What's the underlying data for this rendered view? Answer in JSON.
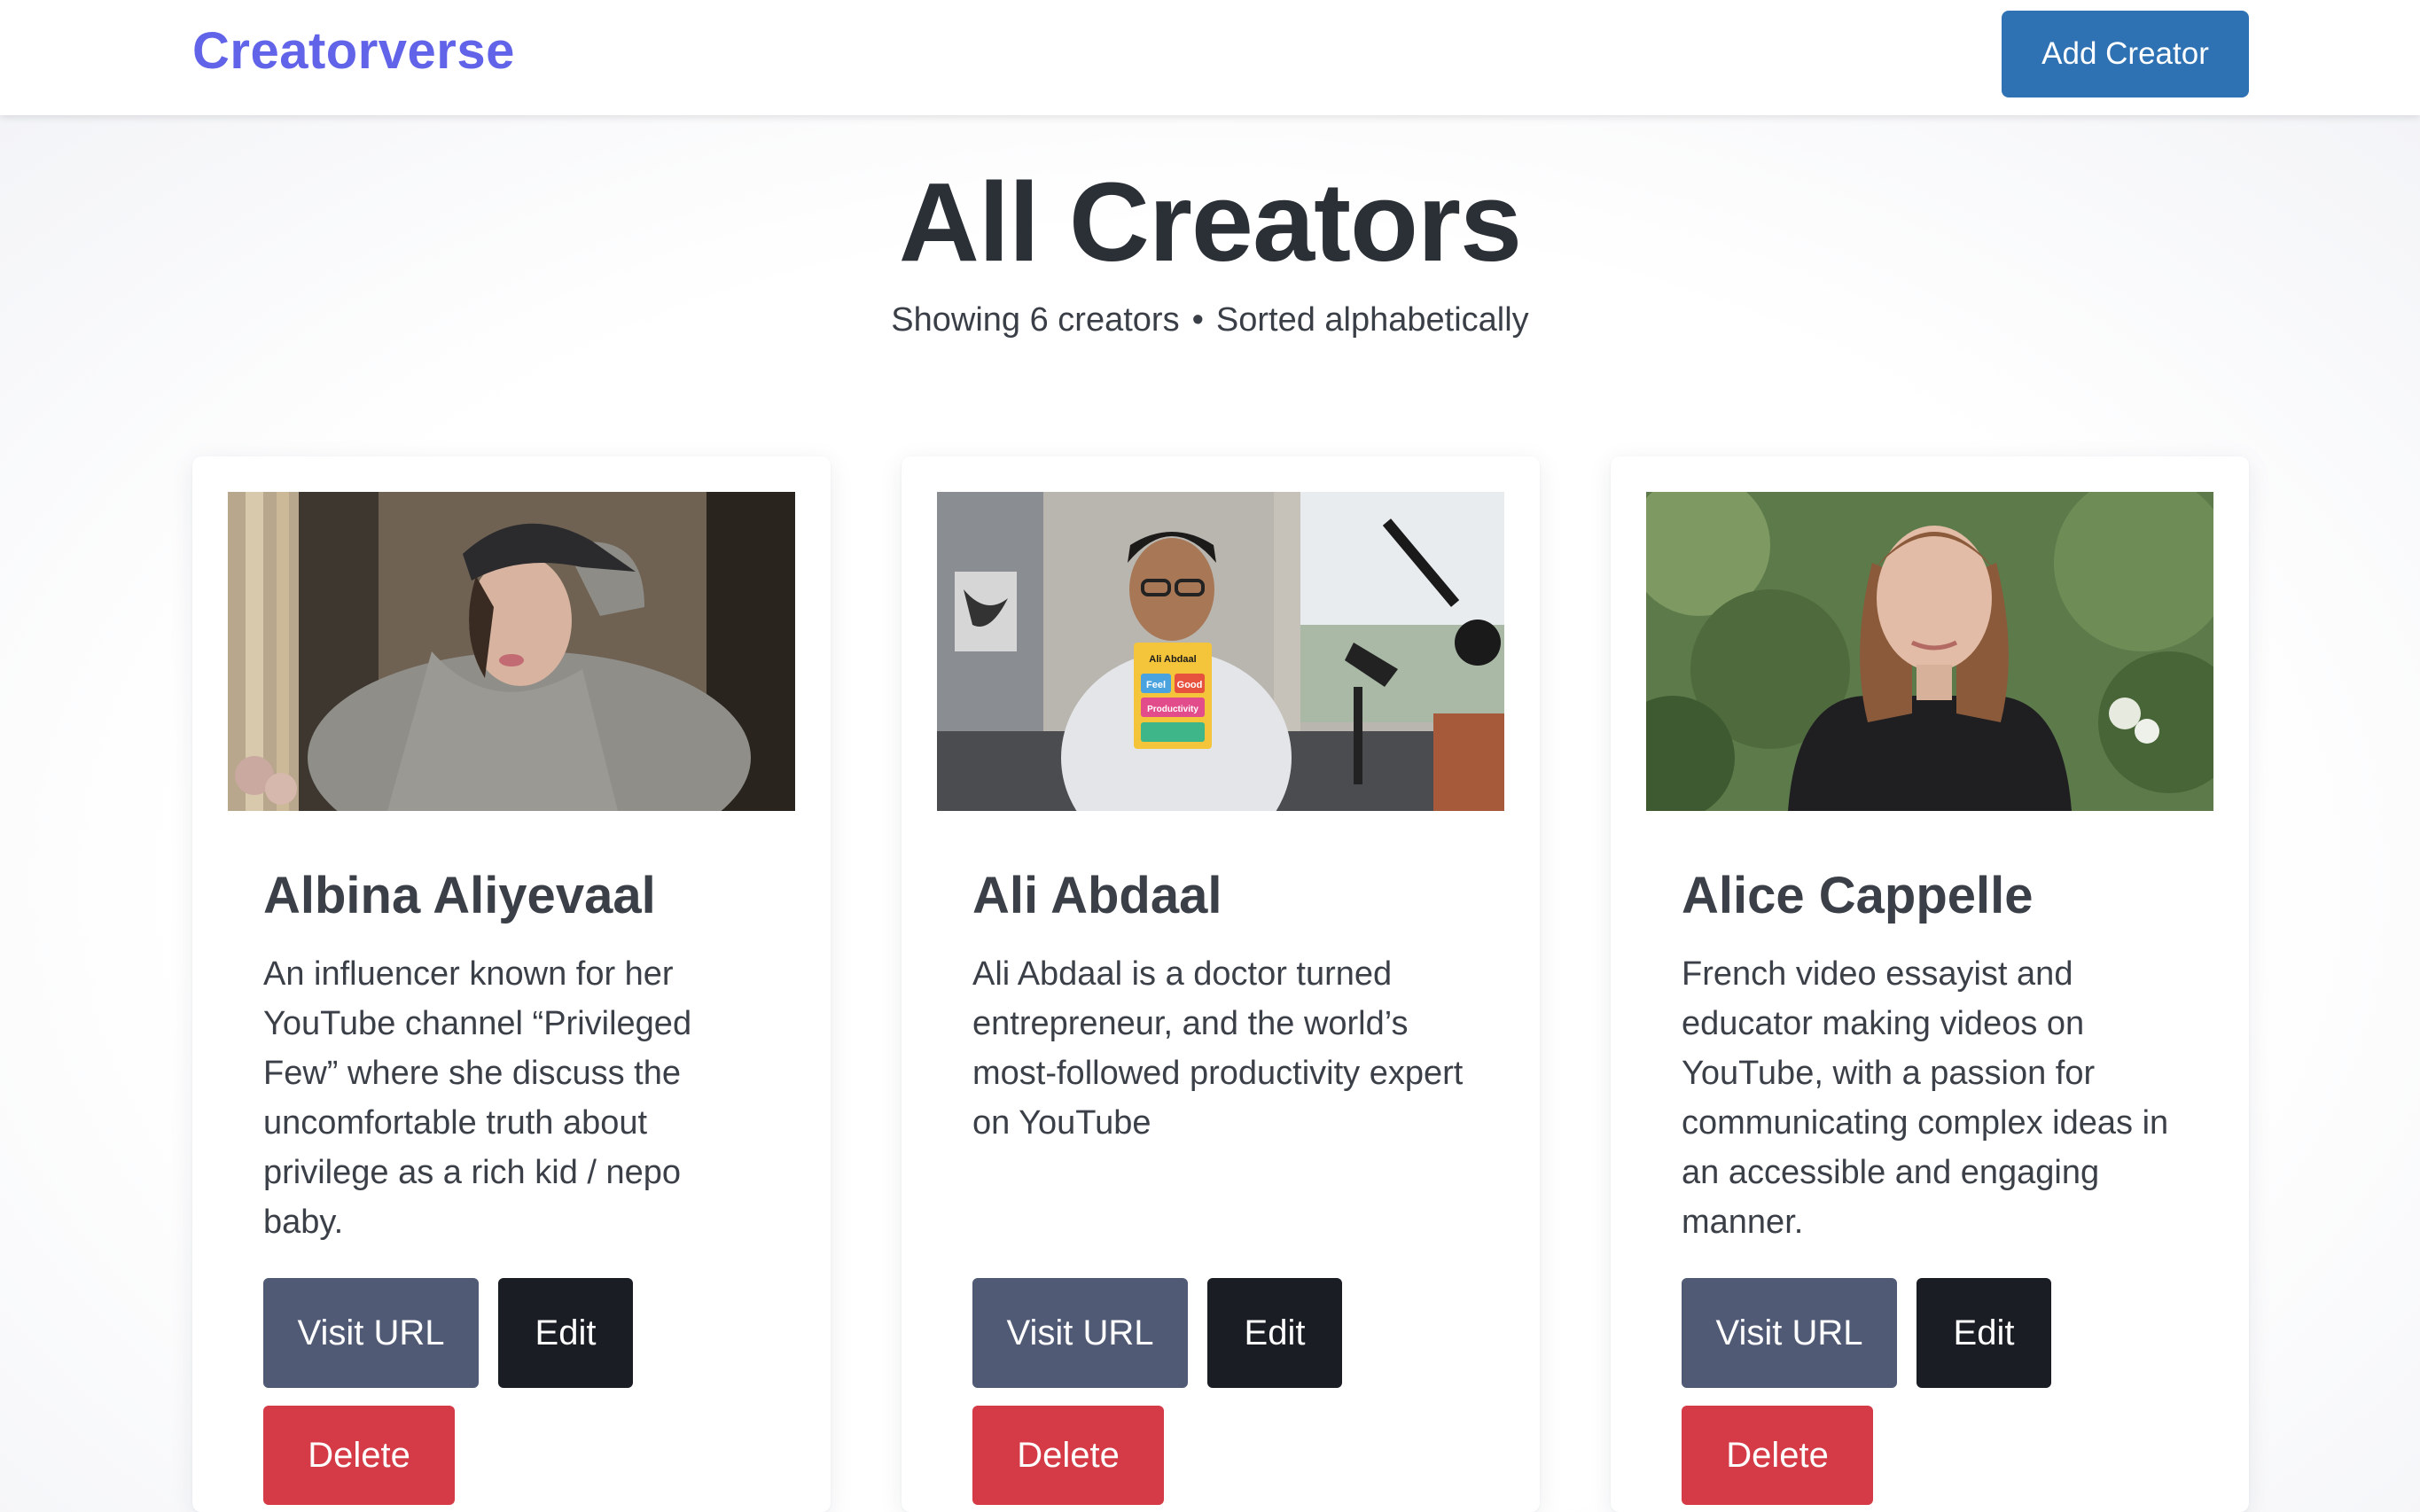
{
  "navbar": {
    "brand": "Creatorverse",
    "add_button_label": "Add Creator"
  },
  "header": {
    "title": "All Creators",
    "count_text": "Showing 6 creators",
    "separator": "•",
    "sort_text": "Sorted alphabetically"
  },
  "colors": {
    "brand": "#6163e8",
    "primary_button": "#2f72b3",
    "visit_button": "#505a75",
    "edit_button": "#1b1d24",
    "delete_button": "#d43b47"
  },
  "cards": [
    {
      "name": "Albina Aliyevaal",
      "description": "An influencer known for her YouTube channel “Privileged Few” where she discuss the uncomfortable truth about privilege as a rich kid / nepo baby.",
      "visit_label": "Visit URL",
      "edit_label": "Edit",
      "delete_label": "Delete"
    },
    {
      "name": "Ali Abdaal",
      "description": "Ali Abdaal is a doctor turned entrepreneur, and the world’s most-followed productivity expert on YouTube",
      "visit_label": "Visit URL",
      "edit_label": "Edit",
      "delete_label": "Delete",
      "book": {
        "author": "Ali Abdaal",
        "word1": "Feel",
        "word2": "Good",
        "word3": "Productivity"
      }
    },
    {
      "name": "Alice Cappelle",
      "description": "French video essayist and educator making videos on YouTube, with a passion for communicating complex ideas in an accessible and engaging manner.",
      "visit_label": "Visit URL",
      "edit_label": "Edit",
      "delete_label": "Delete"
    }
  ]
}
